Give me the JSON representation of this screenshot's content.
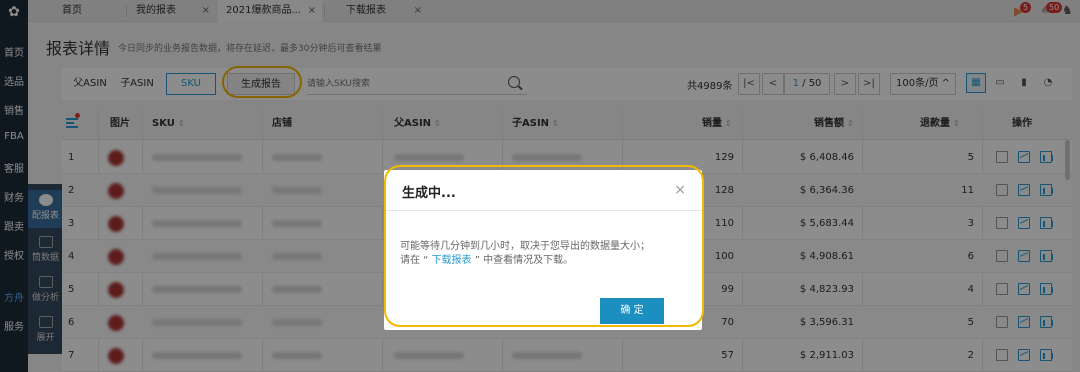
{
  "nav": {
    "items": [
      "首页",
      "选品",
      "销售",
      "FBA",
      "客服",
      "财务",
      "跟卖",
      "授权",
      "方舟",
      "服务"
    ],
    "active_index": 8
  },
  "subpanel": {
    "items": [
      "配报表",
      "筒数据",
      "做分析",
      "展开"
    ],
    "active_index": 0
  },
  "tabs": [
    {
      "label": "首页",
      "closable": false
    },
    {
      "label": "我的报表",
      "closable": true
    },
    {
      "label": "2021爆款商品...",
      "closable": true
    },
    {
      "label": "下载报表",
      "closable": true
    }
  ],
  "badges": {
    "flag": "5",
    "bell": "50"
  },
  "page": {
    "title": "报表详情",
    "subtitle": "今日同步的业务报告数据，将存在延迟，最多30分钟后可查看结果"
  },
  "toolbar": {
    "segments": [
      "父ASIN",
      "子ASIN",
      "SKU"
    ],
    "active_segment": 2,
    "generate_label": "生成报告",
    "search_placeholder": "请输入SKU搜索",
    "total": "共4989条",
    "page_current": "1",
    "page_total": "/ 50",
    "page_size": "100条/页 ^"
  },
  "table": {
    "headers": [
      "图片",
      "SKU",
      "店铺",
      "父ASIN",
      "子ASIN",
      "销量",
      "销售额",
      "退款量",
      "操作"
    ],
    "rows": [
      {
        "idx": "1",
        "qty": "129",
        "sales": "$ 6,408.46",
        "refund": "5"
      },
      {
        "idx": "2",
        "qty": "128",
        "sales": "$ 6,364.36",
        "refund": "11"
      },
      {
        "idx": "3",
        "qty": "110",
        "sales": "$ 5,683.44",
        "refund": "3"
      },
      {
        "idx": "4",
        "qty": "100",
        "sales": "$ 4,908.61",
        "refund": "6"
      },
      {
        "idx": "5",
        "qty": "99",
        "sales": "$ 4,823.93",
        "refund": "4"
      },
      {
        "idx": "6",
        "qty": "70",
        "sales": "$ 3,596.31",
        "refund": "5"
      },
      {
        "idx": "7",
        "qty": "57",
        "sales": "$ 2,911.03",
        "refund": "2"
      }
    ]
  },
  "modal": {
    "title": "生成中...",
    "line1": "可能等待几分钟到几小时，取决于您导出的数据量大小；",
    "line2_pre": "请在 “ ",
    "link": "下载报表",
    "line2_post": " ” 中查看情况及下载。",
    "ok_label": "确 定",
    "close_symbol": "×"
  },
  "colors": {
    "accent": "#2a9bd3",
    "highlight_ring": "#f5b800",
    "nav_bg": "#1c2a3a"
  }
}
